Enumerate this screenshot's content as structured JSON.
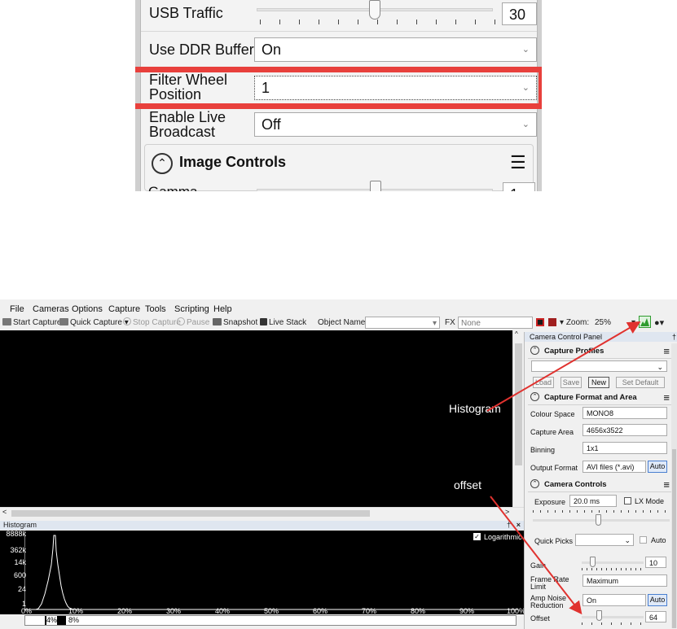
{
  "zoom": {
    "usb_traffic_label": "USB Traffic",
    "usb_traffic_value": "30",
    "usb_traffic_level": 0.45,
    "ddr_label": "Use DDR Buffer",
    "ddr_value": "On",
    "filter_label_1": "Filter Wheel",
    "filter_label_2": "Position",
    "filter_value": "1",
    "broadcast_label_1": "Enable Live",
    "broadcast_label_2": "Broadcast",
    "broadcast_value": "Off",
    "section_image_controls": "Image Controls",
    "gamma_partial_label": "Gamma",
    "gamma_value": "1"
  },
  "app": {
    "menu": [
      "File",
      "Cameras",
      "Options",
      "Capture",
      "Tools",
      "Scripting",
      "Help"
    ],
    "toolbar": {
      "start_capture": "Start Capture",
      "quick_capture": "Quick Capture",
      "stop_capture": "Stop Capture",
      "pause": "Pause",
      "snapshot": "Snapshot",
      "live_stack": "Live Stack",
      "object_name_label": "Object Name :",
      "fx_label": "FX :",
      "fx_value": "None",
      "zoom_label": "Zoom:",
      "zoom_value": "25%"
    },
    "histogram": {
      "title": "Histogram",
      "logarithmic_label": "Logarithmic",
      "y_ticks": [
        "8888k",
        "362k",
        "14k",
        "600",
        "24",
        "1"
      ],
      "x_ticks": [
        "0%",
        "10%",
        "20%",
        "30%",
        "40%",
        "50%",
        "60%",
        "70%",
        "80%",
        "90%",
        "100%"
      ],
      "range_min": "4%",
      "range_max": "8%"
    },
    "panel": {
      "title": "Camera Control Panel",
      "capture_profiles": "Capture Profiles",
      "load": "Load",
      "save": "Save",
      "new": "New",
      "set_default": "Set Default",
      "capture_format": "Capture Format and Area",
      "colour_space_label": "Colour Space",
      "colour_space_value": "MONO8",
      "capture_area_label": "Capture Area",
      "capture_area_value": "4656x3522",
      "binning_label": "Binning",
      "binning_value": "1x1",
      "output_format_label": "Output Format",
      "output_format_value": "AVI files (*.avi)",
      "auto": "Auto",
      "camera_controls": "Camera Controls",
      "exposure_label": "Exposure",
      "exposure_value": "20.0 ms",
      "lx_mode": "LX Mode",
      "quick_picks_label": "Quick Picks",
      "gain_label": "Gain",
      "gain_value": "10",
      "frame_rate_label_1": "Frame Rate",
      "frame_rate_label_2": "Limit",
      "frame_rate_value": "Maximum",
      "amp_noise_label_1": "Amp Noise",
      "amp_noise_label_2": "Reduction",
      "amp_noise_value": "On",
      "offset_label": "Offset",
      "offset_value": "64"
    },
    "annotations": {
      "histogram": "Histogram",
      "offset": "offset"
    },
    "colors": {
      "highlight_red": "#e8403c",
      "arrow_red": "#e0322f",
      "histogram_active_green": "#2e9b2e"
    }
  }
}
